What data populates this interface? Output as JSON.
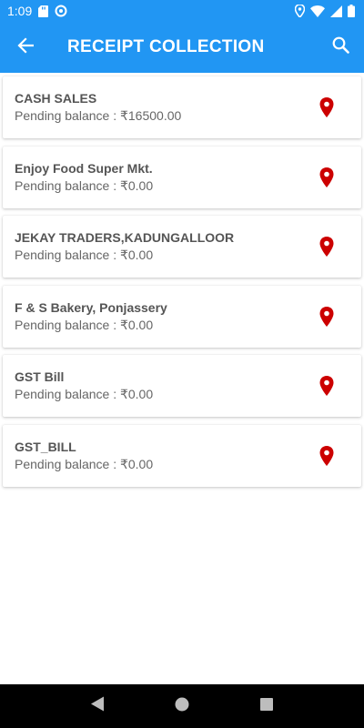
{
  "status_bar": {
    "time": "1:09",
    "icons": [
      "sd-card-icon",
      "sync-icon",
      "location-icon",
      "wifi-icon",
      "signal-icon",
      "battery-icon"
    ]
  },
  "app_bar": {
    "title": "RECEIPT COLLECTION",
    "back_icon": "arrow-left-icon",
    "search_icon": "search-icon",
    "color": "#2196f3"
  },
  "customers": [
    {
      "name": "CASH SALES",
      "balance": "Pending balance : ₹16500.00"
    },
    {
      "name": "Enjoy Food Super Mkt.",
      "balance": "Pending balance : ₹0.00"
    },
    {
      "name": "JEKAY TRADERS,KADUNGALLOOR",
      "balance": "Pending balance : ₹0.00"
    },
    {
      "name": "F & S Bakery, Ponjassery",
      "balance": "Pending balance : ₹0.00"
    },
    {
      "name": "GST Bill",
      "balance": "Pending balance : ₹0.00"
    },
    {
      "name": "GST_BILL",
      "balance": "Pending balance : ₹0.00"
    }
  ],
  "pin_color": "#cc0000",
  "nav_bar": {
    "buttons": [
      "back-triangle-icon",
      "home-circle-icon",
      "recents-square-icon"
    ]
  }
}
